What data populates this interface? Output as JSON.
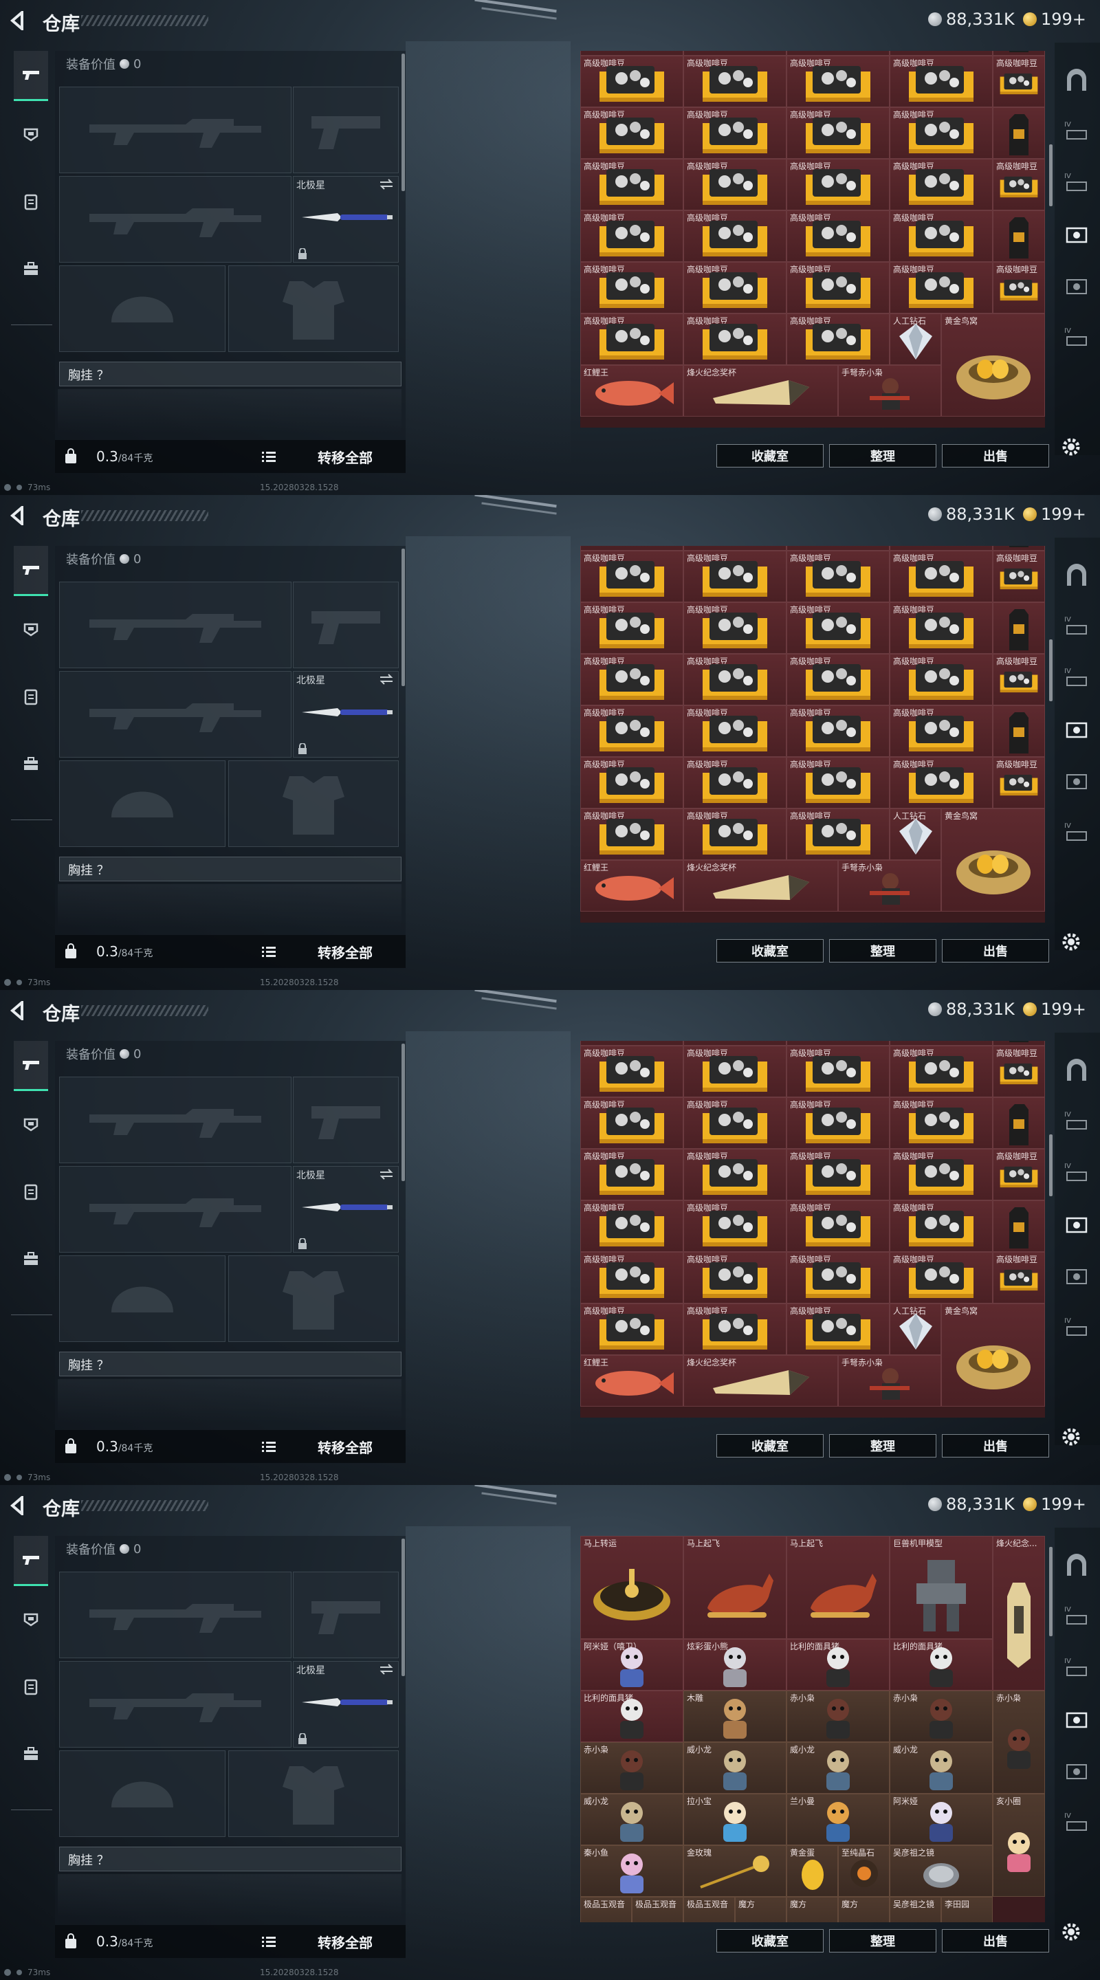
{
  "app": {
    "title": "仓库",
    "silver": "88,331K",
    "gold": "199+"
  },
  "equipment": {
    "value_label": "装备价值",
    "value": "0",
    "slot_name": "北极星",
    "chest_label": "胸挂 ？",
    "weight": "0.3",
    "weight_cap": "/84千克",
    "move_all": "转移全部"
  },
  "status": {
    "ping": "73ms",
    "build": "15.20280328.1528"
  },
  "actions": {
    "collection": "收藏室",
    "organize": "整理",
    "sell": "出售"
  },
  "names": {
    "coffee": "高级咖啡豆",
    "carp": "红鲤王",
    "trophy": "烽火纪念奖杯",
    "crossbow": "手弩赤小枭",
    "diamond": "人工钻石",
    "nest": "黄金鸟窝",
    "wheel": "马上转运",
    "horse": "马上起飞",
    "mech": "巨兽机甲模型",
    "trophy_short": "烽火纪念...",
    "ayi": "阿米娅（嘻卫）",
    "color_bear": "炫彩蛋小熊",
    "billy": "比利的面具猪",
    "wood": "木雕",
    "chixiao": "赤小枭",
    "weixiaolong": "威小龙",
    "lalabao": "拉小宝",
    "lanxiaoman": "兰小曼",
    "amiyaq": "阿米娅",
    "qingxiaoshu": "亥小圈",
    "gold_rose": "金玫瑰",
    "gold_egg": "黄金蛋",
    "diamond2": "至纯晶石",
    "qinxiaoyu": "秦小鱼",
    "jade": "极品玉观音",
    "magic": "魔方",
    "jingangcup": "吴彦祖之镜",
    "goldcup": "李田园"
  },
  "frames": [
    {
      "id": "frame-1"
    },
    {
      "id": "frame-2"
    },
    {
      "id": "frame-3"
    },
    {
      "id": "frame-4"
    }
  ]
}
